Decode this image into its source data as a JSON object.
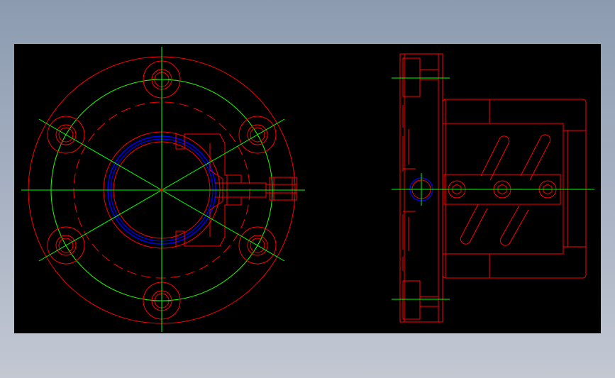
{
  "colors": {
    "background": "#000000",
    "outline": "#ff0000",
    "centerline": "#00ff00",
    "bearing": "#0000ff",
    "page": "#a9b3c4"
  },
  "views": [
    {
      "name": "front-view",
      "description_shown": false
    },
    {
      "name": "side-view",
      "description_shown": false
    }
  ]
}
